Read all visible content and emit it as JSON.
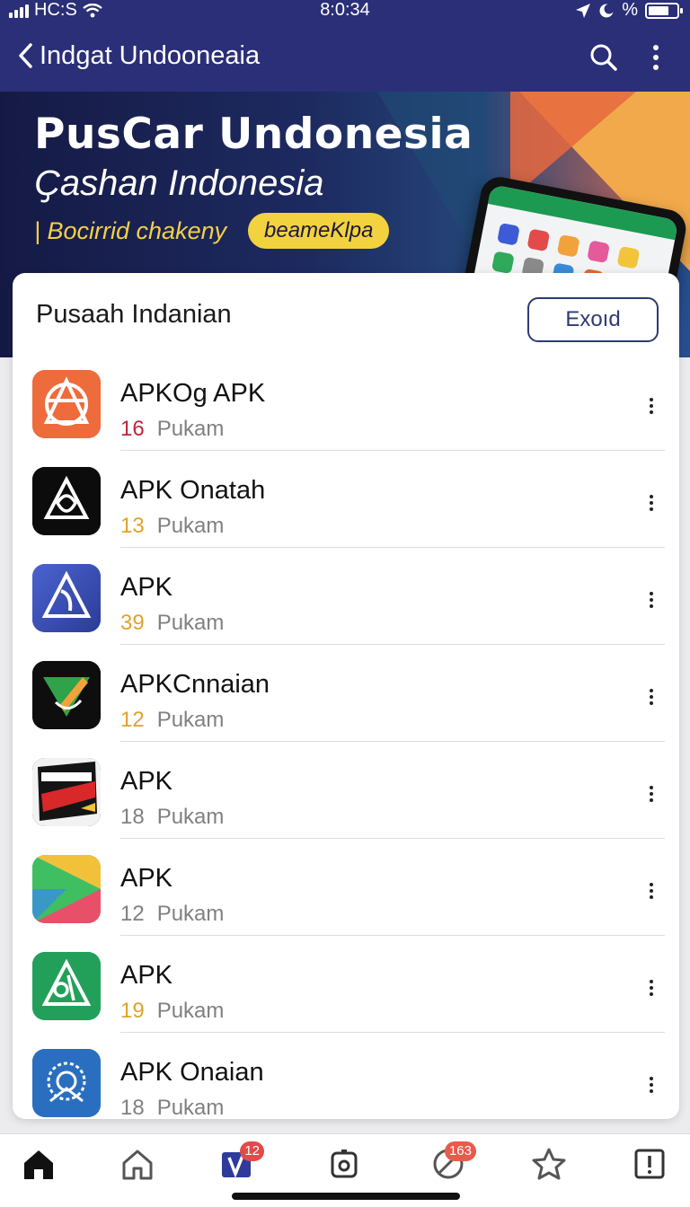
{
  "status_bar": {
    "carrier": "HC:S",
    "time": "8:0:34",
    "battery": "%"
  },
  "app_bar": {
    "title": "Indgat Undooneaia"
  },
  "banner": {
    "title": "PusCar Undonesia",
    "subtitle": "Ҫashan Indonesia",
    "tagline": "| Bocirrid chakeny",
    "pill": "beameKlpa"
  },
  "section": {
    "title": "Pusaah Indanian",
    "button_label": "Exoıd"
  },
  "apps": [
    {
      "name": "APKOg APK",
      "count": "16",
      "unit": "Pukam",
      "count_color": "#c0243a",
      "icon": "compass-star-icon",
      "icon_bg": "#ee6b3b"
    },
    {
      "name": "APK Onatah",
      "count": "13",
      "unit": "Pukam",
      "count_color": "#e0a22b",
      "icon": "triangle-heart-icon",
      "icon_bg": "#0c0c0c"
    },
    {
      "name": "APK",
      "count": "39",
      "unit": "Pukam",
      "count_color": "#e0a22b",
      "icon": "triangle-blue-icon",
      "icon_bg": "#3c4fb0"
    },
    {
      "name": "APKCnnaian",
      "count": "12",
      "unit": "Pukam",
      "count_color": "#e0a22b",
      "icon": "pencil-triangle-icon",
      "icon_bg": "#0e0e0e"
    },
    {
      "name": "APK",
      "count": "18",
      "unit": "Pukam",
      "count_color": "#808080",
      "icon": "kbgtel-logo-icon",
      "icon_bg": "#141414"
    },
    {
      "name": "APK",
      "count": "12",
      "unit": "Pukam",
      "count_color": "#808080",
      "icon": "play-triangle-icon",
      "icon_bg": "#ffffff"
    },
    {
      "name": "APK",
      "count": "19",
      "unit": "Pukam",
      "count_color": "#e0a22b",
      "icon": "triangle-green-icon",
      "icon_bg": "#22a05a"
    },
    {
      "name": "APK Onaian",
      "count": "18",
      "unit": "Pukam",
      "count_color": "#808080",
      "icon": "gear-badge-icon",
      "icon_bg": "#2a6fbf"
    }
  ],
  "bottom_nav": {
    "items": [
      {
        "name": "home-filled",
        "badge": ""
      },
      {
        "name": "home-outline",
        "badge": ""
      },
      {
        "name": "apps",
        "badge": "12"
      },
      {
        "name": "camera",
        "badge": ""
      },
      {
        "name": "blocked",
        "badge": "163"
      },
      {
        "name": "star",
        "badge": ""
      },
      {
        "name": "alert",
        "badge": ""
      }
    ]
  },
  "colors": {
    "topbar": "#2b2f78",
    "accent_yellow": "#f3d23f",
    "button_border": "#2e3b72"
  }
}
